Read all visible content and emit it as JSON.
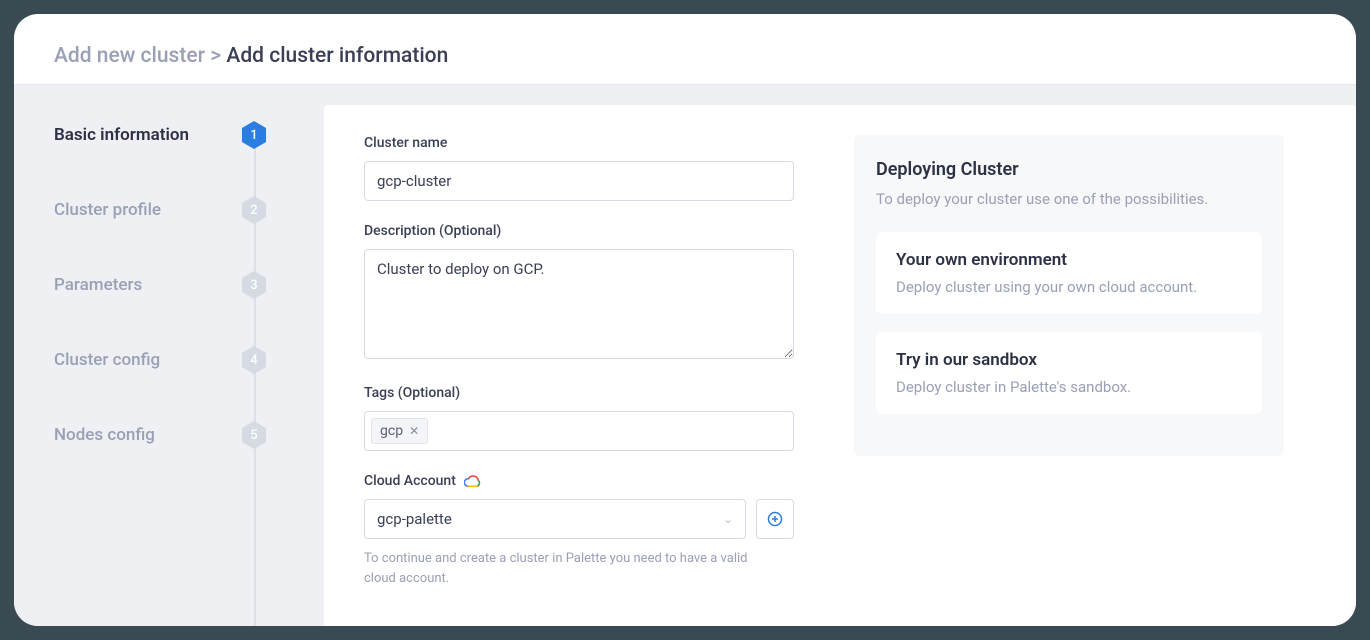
{
  "breadcrumb": {
    "parent": "Add new cluster",
    "sep": ">",
    "current": "Add cluster information"
  },
  "steps": [
    {
      "num": "1",
      "label": "Basic information",
      "active": true
    },
    {
      "num": "2",
      "label": "Cluster profile",
      "active": false
    },
    {
      "num": "3",
      "label": "Parameters",
      "active": false
    },
    {
      "num": "4",
      "label": "Cluster config",
      "active": false
    },
    {
      "num": "5",
      "label": "Nodes config",
      "active": false
    }
  ],
  "form": {
    "cluster_name_label": "Cluster name",
    "cluster_name_value": "gcp-cluster",
    "description_label": "Description (Optional)",
    "description_value": "Cluster to deploy on GCP.",
    "tags_label": "Tags (Optional)",
    "tags": [
      {
        "text": "gcp"
      }
    ],
    "cloud_account_label": "Cloud Account",
    "cloud_account_value": "gcp-palette",
    "cloud_account_hint": "To continue and create a cluster in Palette you need to have a valid cloud account."
  },
  "deploy": {
    "title": "Deploying Cluster",
    "subtitle": "To deploy your cluster use one of the possibilities.",
    "options": [
      {
        "title": "Your own environment",
        "desc": "Deploy cluster using your own cloud account."
      },
      {
        "title": "Try in our sandbox",
        "desc": "Deploy cluster in Palette's sandbox."
      }
    ]
  }
}
